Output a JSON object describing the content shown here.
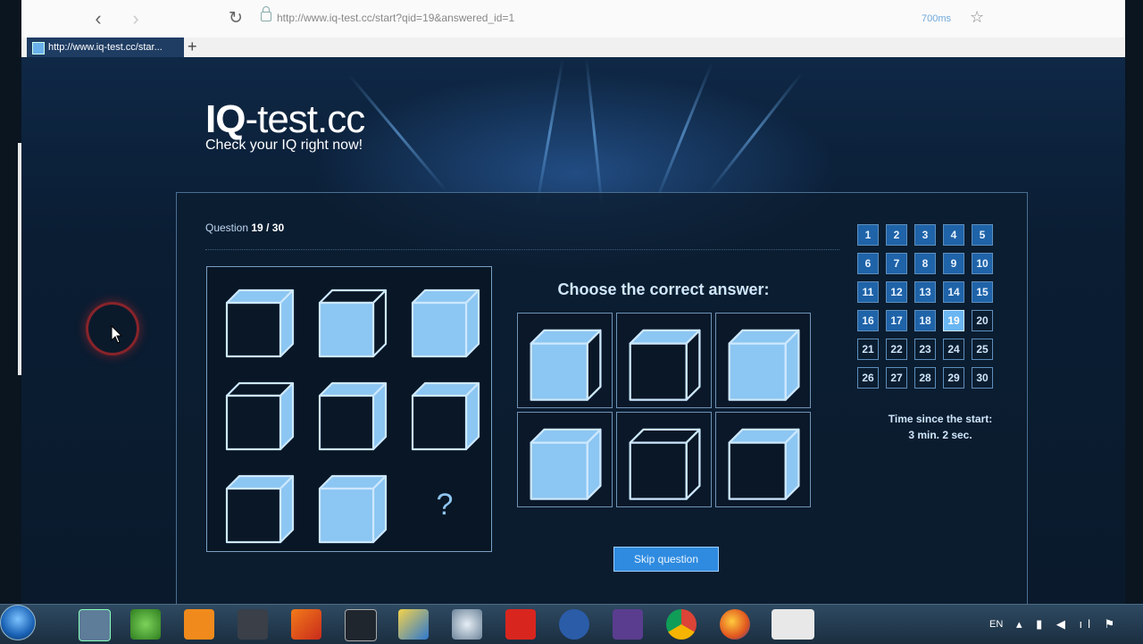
{
  "browser": {
    "url": "http://www.iq-test.cc/start?qid=19&answered_id=1",
    "timing": "700ms",
    "tab_title": "http://www.iq-test.cc/star...",
    "new_tab_label": "+",
    "back_label": "‹",
    "forward_label": "›",
    "reload_label": "↻",
    "star_label": "☆"
  },
  "site": {
    "brand_bold": "IQ",
    "brand_rest": "-test.cc",
    "tagline": "Check your IQ right now!"
  },
  "question": {
    "label": "Question",
    "current": "19",
    "separator": "/",
    "total": "30"
  },
  "puzzle": {
    "cells": [
      {
        "front": "dark",
        "top": "light",
        "side": "light"
      },
      {
        "front": "light",
        "top": "dark",
        "side": "dark"
      },
      {
        "front": "light",
        "top": "light",
        "side": "light"
      },
      {
        "front": "dark",
        "top": "dark",
        "side": "light"
      },
      {
        "front": "dark",
        "top": "light",
        "side": "light"
      },
      {
        "front": "dark",
        "top": "light",
        "side": "light"
      },
      {
        "front": "dark",
        "top": "light",
        "side": "light"
      },
      {
        "front": "light",
        "top": "light",
        "side": "light"
      }
    ],
    "missing_symbol": "?"
  },
  "answers": {
    "prompt": "Choose the correct answer:",
    "options": [
      {
        "front": "light",
        "top": "light",
        "side": "dark"
      },
      {
        "front": "dark",
        "top": "light",
        "side": "dark"
      },
      {
        "front": "light",
        "top": "light",
        "side": "light"
      },
      {
        "front": "light",
        "top": "light",
        "side": "light"
      },
      {
        "front": "dark",
        "top": "dark",
        "side": "dark"
      },
      {
        "front": "dark",
        "top": "light",
        "side": "light"
      }
    ]
  },
  "skip_label": "Skip question",
  "question_nav": {
    "numbers": [
      "1",
      "2",
      "3",
      "4",
      "5",
      "6",
      "7",
      "8",
      "9",
      "10",
      "11",
      "12",
      "13",
      "14",
      "15",
      "16",
      "17",
      "18",
      "19",
      "20",
      "21",
      "22",
      "23",
      "24",
      "25",
      "26",
      "27",
      "28",
      "29",
      "30"
    ],
    "answered_up_to": 18,
    "current": 19
  },
  "timer": {
    "label": "Time since the start:",
    "value": "3 min. 2 sec."
  },
  "taskbar": {
    "apps": [
      "start-orb",
      "file-explorer",
      "parrot-app",
      "generic-doc-app",
      "clapper-app",
      "matlab-app",
      "logo-v8-app",
      "paint-app",
      "atom-app",
      "red-app",
      "as-app",
      "calc-app",
      "chrome-app",
      "firefox-app",
      "brave-app"
    ],
    "language": "EN"
  },
  "colors": {
    "cube_light": "#8cc6f2",
    "cube_dark": "#0a1726",
    "cube_stroke": "#cde8ff",
    "accent": "#2f8be0"
  }
}
